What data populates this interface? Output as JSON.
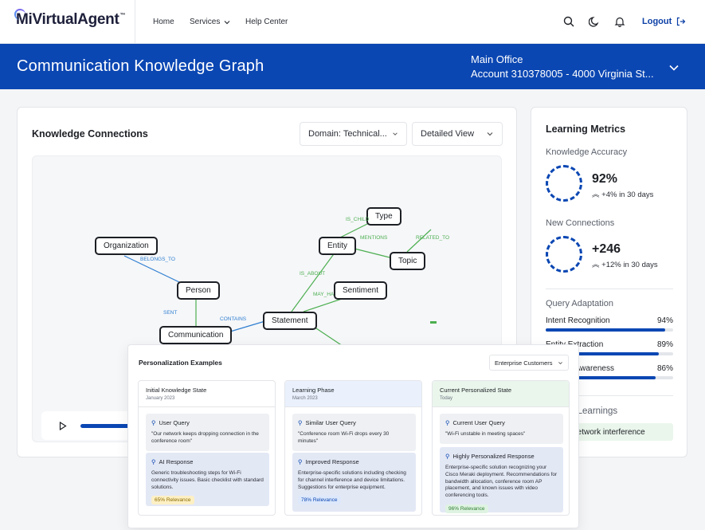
{
  "brand": {
    "name": "MiVirtualAgent",
    "tm": "™"
  },
  "nav": {
    "home": "Home",
    "services": "Services",
    "help": "Help Center",
    "logout": "Logout"
  },
  "icons": {
    "search": "search-icon",
    "theme": "moon-icon",
    "bell": "bell-icon",
    "logout": "logout-icon"
  },
  "banner": {
    "title": "Communication Knowledge Graph",
    "office": "Main Office",
    "account": "Account 310378005 - 4000 Virginia St..."
  },
  "knowledge": {
    "title": "Knowledge Connections",
    "domain_select": "Domain: Technical...",
    "view_select": "Detailed View",
    "nodes": {
      "organization": "Organization",
      "person": "Person",
      "communication": "Communication",
      "statement": "Statement",
      "entity": "Entity",
      "type": "Type",
      "topic": "Topic",
      "sentiment": "Sentiment"
    },
    "edges": {
      "belongs_to": "BELONGS_TO",
      "sent": "SENT",
      "contains": "CONTAINS",
      "is_about": "IS_ABOUT",
      "may_have": "MAY_HA",
      "is_child": "IS_CHILD",
      "mentions": "MENTIONS",
      "related_to": "RELATED_TO"
    }
  },
  "metrics": {
    "title": "Learning Metrics",
    "accuracy": {
      "label": "Knowledge Accuracy",
      "value": "92%",
      "delta": "+4% in 30 days"
    },
    "connections": {
      "label": "New Connections",
      "value": "+246",
      "delta": "+12% in 30 days"
    },
    "adaptation": {
      "label": "Query Adaptation",
      "bars": [
        {
          "label": "Intent Recognition",
          "pct_text": "94%",
          "value": 94
        },
        {
          "label": "Entity Extraction",
          "pct_text": "89%",
          "value": 89
        },
        {
          "label": "Context Awareness",
          "pct_text": "86%",
          "value": 86
        }
      ]
    },
    "recent": {
      "label": "Recent Learnings",
      "item": "Wi-Fi network interference"
    }
  },
  "personalization": {
    "title": "Personalization Examples",
    "select": "Enterprise Customers",
    "columns": [
      {
        "title": "Initial Knowledge State",
        "date": "January 2023",
        "q_label": "User Query",
        "q_text": "\"Our network keeps dropping connection in the conference room\"",
        "r_label": "AI Response",
        "r_text": "Generic troubleshooting steps for Wi-Fi connectivity issues. Basic checklist with standard solutions.",
        "relevance": "65% Relevance"
      },
      {
        "title": "Learning Phase",
        "date": "March 2023",
        "q_label": "Similar User Query",
        "q_text": "\"Conference room Wi-Fi drops every 30 minutes\"",
        "r_label": "Improved Response",
        "r_text": "Enterprise-specific solutions including checking for channel interference and device limitations. Suggestions for enterprise equipment.",
        "relevance": "78% Relevance"
      },
      {
        "title": "Current Personalized State",
        "date": "Today",
        "q_label": "Current User Query",
        "q_text": "\"Wi-Fi unstable in meeting spaces\"",
        "r_label": "Highly Personalized Response",
        "r_text": "Enterprise-specific solution recognizing your Cisco Meraki deployment. Recommendations for bandwidth allocation, conference room AP placement, and known issues with video conferencing tools.",
        "relevance": "96% Relevance"
      }
    ]
  },
  "colors": {
    "brand": "#0b47b3",
    "edge_green": "#4caf50",
    "edge_blue": "#2f7fd1"
  }
}
